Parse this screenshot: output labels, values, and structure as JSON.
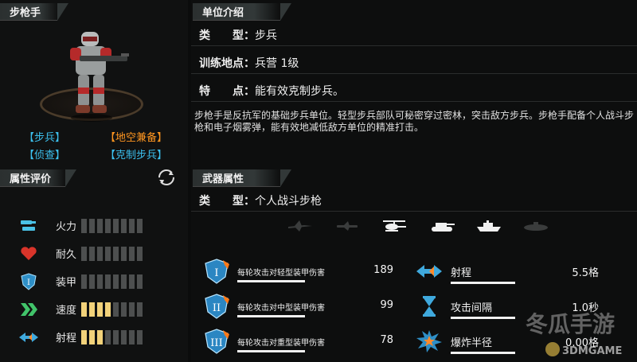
{
  "left_panel": {
    "unit_tab": "步枪手",
    "tags": [
      {
        "text": "【步兵】",
        "color": "#3cc0ee"
      },
      {
        "text": "【地空兼备】",
        "color": "#ff9620"
      },
      {
        "text": "【侦查】",
        "color": "#3cc0ee"
      },
      {
        "text": "【克制步兵】",
        "color": "#3cc0ee"
      }
    ],
    "attr_tab": "属性评价",
    "attributes": [
      {
        "label": "火力",
        "icon": "firepower-icon",
        "level": 0,
        "max": 8
      },
      {
        "label": "耐久",
        "icon": "heart-icon",
        "level": 0,
        "max": 8
      },
      {
        "label": "装甲",
        "icon": "armor-shield-icon",
        "level": 0,
        "max": 8
      },
      {
        "label": "速度",
        "icon": "speed-chevron-icon",
        "level": 4,
        "max": 8
      },
      {
        "label": "射程",
        "icon": "range-arrow-icon",
        "level": 3,
        "max": 8
      }
    ]
  },
  "right_panel": {
    "intro_tab": "单位介绍",
    "type_label": "类　　型：",
    "type_value": "步兵",
    "train_label": "训练地点：",
    "train_value": "兵营 1级",
    "feature_label": "特　　点：",
    "feature_value": "能有效克制步兵。",
    "description": "步枪手是反抗军的基础步兵单位。轻型步兵部队可秘密穿过密林，突击敌方步兵。步枪手配备个人战斗步枪和电子烟雾弹，能有效地减低敌方单位的精准打击。",
    "weapon_tab": "武器属性",
    "weapon_type_label": "类　　型：",
    "weapon_type_value": "个人战斗步枪",
    "target_icons": [
      {
        "name": "jet-fighter-icon",
        "active": false
      },
      {
        "name": "bomber-icon",
        "active": false
      },
      {
        "name": "helicopter-icon",
        "active": true
      },
      {
        "name": "tank-icon",
        "active": true
      },
      {
        "name": "ship-icon",
        "active": true
      },
      {
        "name": "submarine-icon",
        "active": false
      }
    ],
    "damage_stats": [
      {
        "roman": "I",
        "label": "每轮攻击对轻型装甲伤害",
        "value": "189",
        "bar": 0.5
      },
      {
        "roman": "II",
        "label": "每轮攻击对中型装甲伤害",
        "value": "99",
        "bar": 0.5
      },
      {
        "roman": "III",
        "label": "每轮攻击对重型装甲伤害",
        "value": "78",
        "bar": 0.5
      }
    ],
    "other_stats": [
      {
        "icon": "range-arrow-icon",
        "label": "射程",
        "value": "5.5格",
        "bar": 0.45
      },
      {
        "icon": "hourglass-icon",
        "label": "攻击间隔",
        "value": "1.0秒",
        "bar": 0.45
      },
      {
        "icon": "explosion-icon",
        "label": "爆炸半径",
        "value": "0.00格",
        "bar": 0.45
      }
    ]
  },
  "watermark": {
    "brand_cn": "冬瓜手游",
    "brand_en": "3DMGAME"
  }
}
